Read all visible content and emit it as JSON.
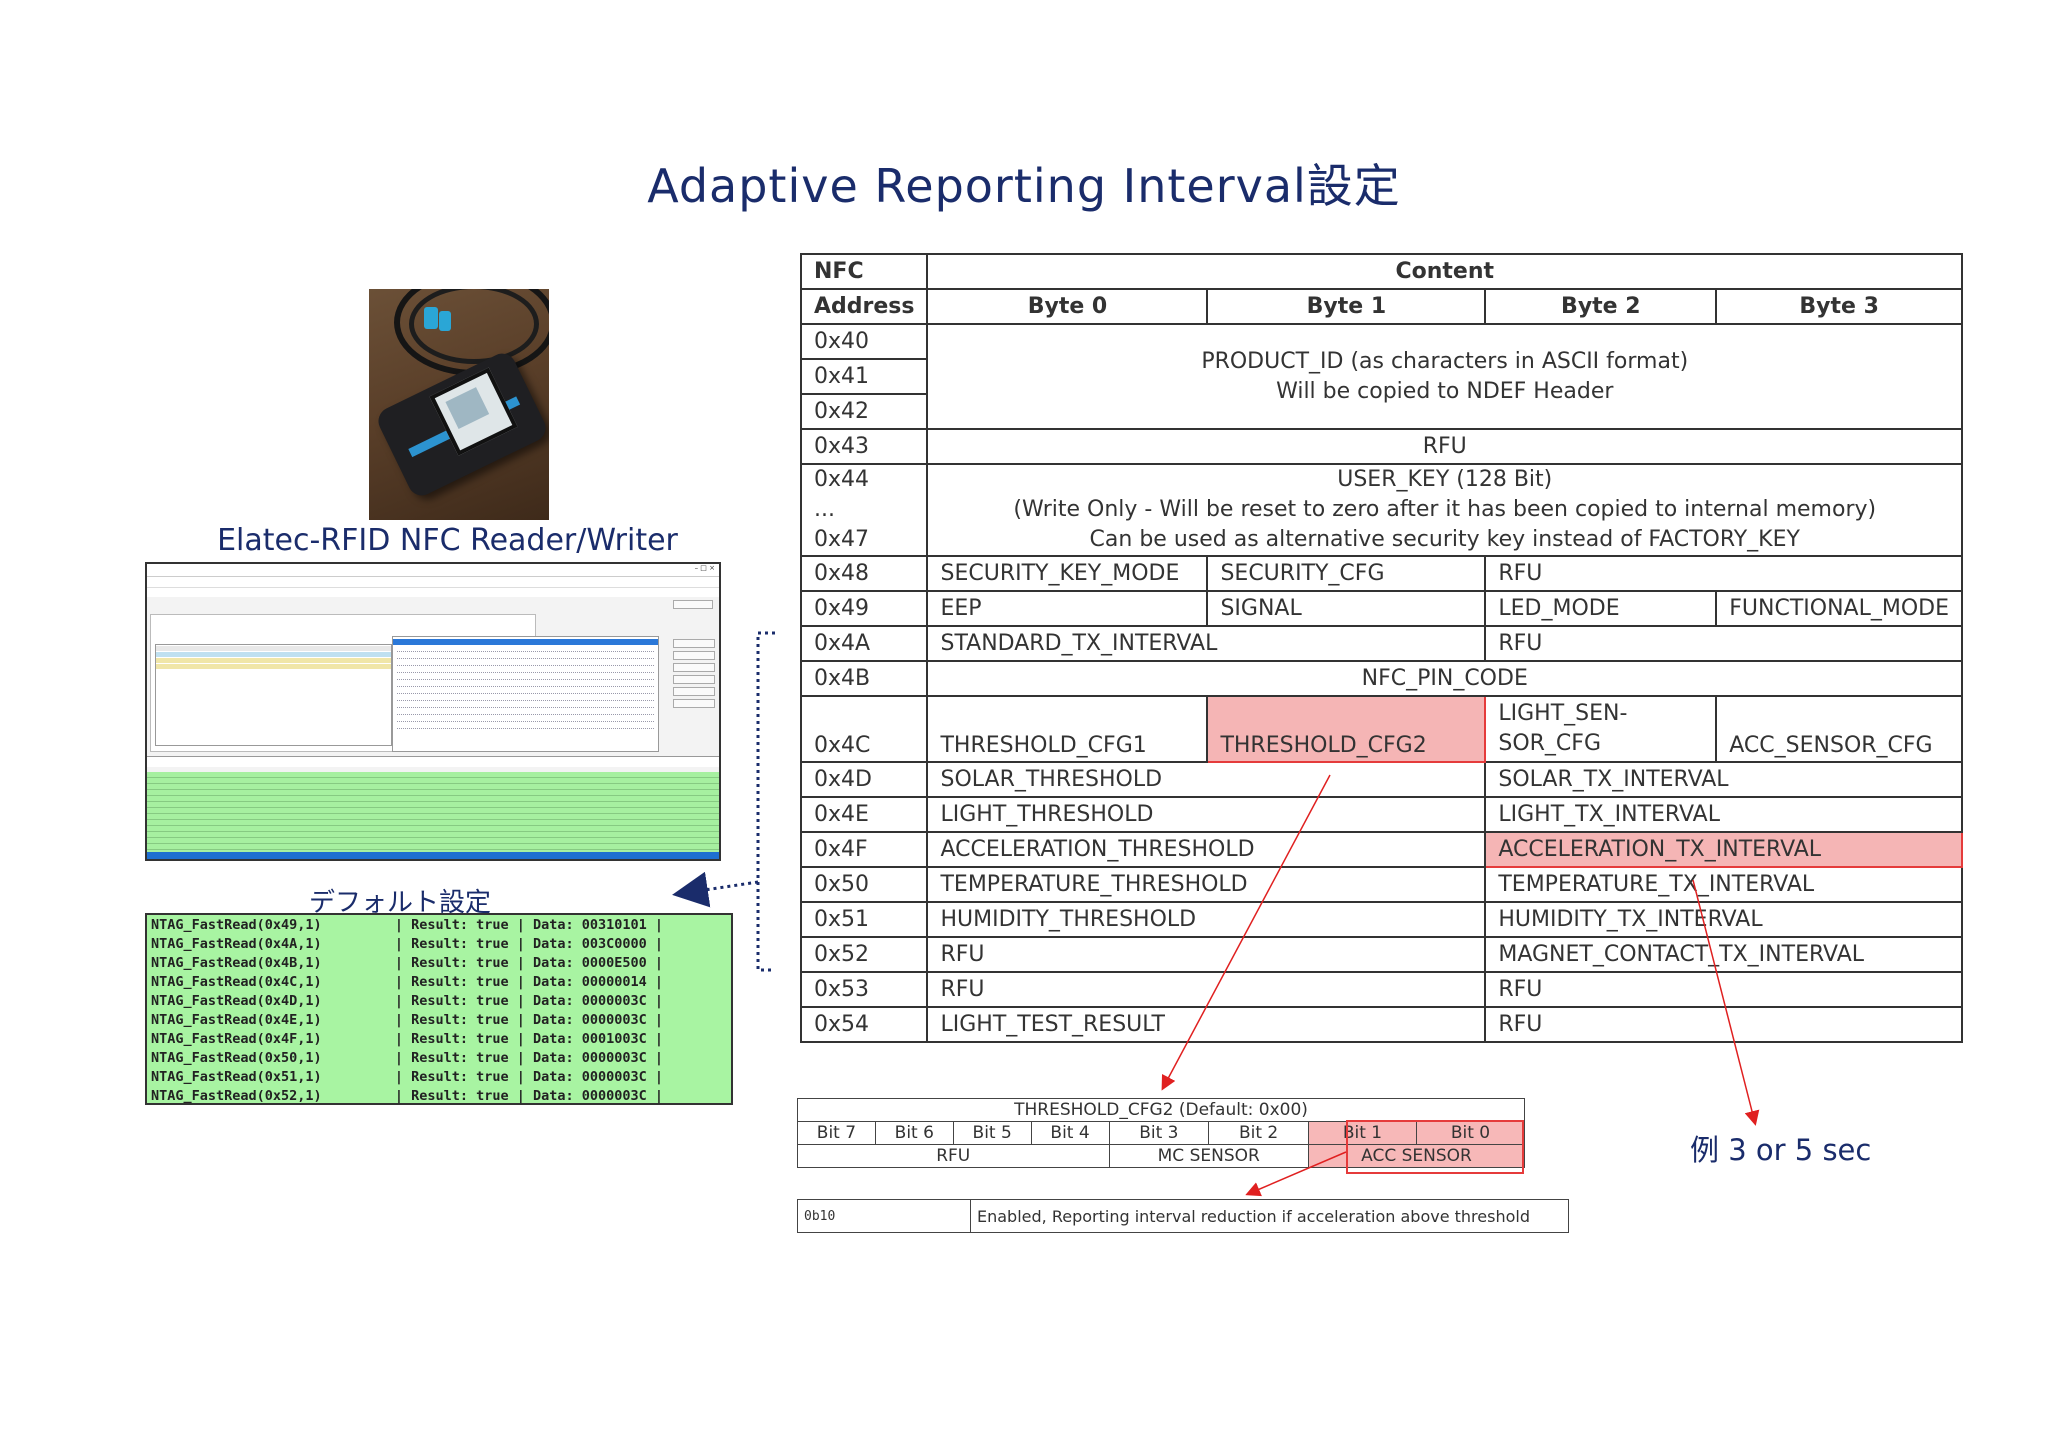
{
  "title": "Adaptive  Reporting  Interval設定",
  "reader_caption": "Elatec-RFID NFC Reader/Writer",
  "default_caption": "デフォルト設定",
  "example_note": "例 3 or 5 sec",
  "console_lines": [
    "NTAG_FastRead(0x49,1)         | Result: true | Data: 00310101 |",
    "NTAG_FastRead(0x4A,1)         | Result: true | Data: 003C0000 |",
    "NTAG_FastRead(0x4B,1)         | Result: true | Data: 0000E500 |",
    "NTAG_FastRead(0x4C,1)         | Result: true | Data: 00000014 |",
    "NTAG_FastRead(0x4D,1)         | Result: true | Data: 0000003C |",
    "NTAG_FastRead(0x4E,1)         | Result: true | Data: 0000003C |",
    "NTAG_FastRead(0x4F,1)         | Result: true | Data: 0001003C |",
    "NTAG_FastRead(0x50,1)         | Result: true | Data: 0000003C |",
    "NTAG_FastRead(0x51,1)         | Result: true | Data: 0000003C |",
    "NTAG_FastRead(0x52,1)         | Result: true | Data: 0000003C |"
  ],
  "register_table": {
    "header": {
      "nfc": "NFC",
      "address": "Address",
      "content": "Content",
      "byte0": "Byte 0",
      "byte1": "Byte 1",
      "byte2": "Byte 2",
      "byte3": "Byte 3"
    },
    "addr": {
      "a40": "0x40",
      "a41": "0x41",
      "a42": "0x42",
      "a43": "0x43",
      "a44": "0x44",
      "dots": "...",
      "a47": "0x47",
      "a48": "0x48",
      "a49": "0x49",
      "a4a": "0x4A",
      "a4b": "0x4B",
      "a4c": "0x4C",
      "a4d": "0x4D",
      "a4e": "0x4E",
      "a4f": "0x4F",
      "a50": "0x50",
      "a51": "0x51",
      "a52": "0x52",
      "a53": "0x53",
      "a54": "0x54"
    },
    "product_id_1": "PRODUCT_ID (as characters in ASCII format)",
    "product_id_2": "Will be copied to NDEF Header",
    "rfu": "RFU",
    "user_key_1": "USER_KEY (128 Bit)",
    "user_key_2": "(Write Only - Will be reset to zero after it has been copied to internal memory)",
    "user_key_3": "Can be used as alternative security key instead of FACTORY_KEY",
    "security_key_mode": "SECURITY_KEY_MODE",
    "security_cfg": "SECURITY_CFG",
    "eep": "EEP",
    "signal": "SIGNAL",
    "led_mode": "LED_MODE",
    "functional_mode": "FUNCTIONAL_MODE",
    "standard_tx_interval": "STANDARD_TX_INTERVAL",
    "nfc_pin_code": "NFC_PIN_CODE",
    "threshold_cfg1": "THRESHOLD_CFG1",
    "threshold_cfg2": "THRESHOLD_CFG2",
    "light_sensor_cfg_1": "LIGHT_SEN-",
    "light_sensor_cfg_2": "SOR_CFG",
    "acc_sensor_cfg": "ACC_SENSOR_CFG",
    "solar_threshold": "SOLAR_THRESHOLD",
    "solar_tx_interval": "SOLAR_TX_INTERVAL",
    "light_threshold": "LIGHT_THRESHOLD",
    "light_tx_interval": "LIGHT_TX_INTERVAL",
    "acceleration_threshold": "ACCELERATION_THRESHOLD",
    "acceleration_tx_interval": "ACCELERATION_TX_INTERVAL",
    "temperature_threshold": "TEMPERATURE_THRESHOLD",
    "temperature_tx_interval": "TEMPERATURE_TX_INTERVAL",
    "humidity_threshold": "HUMIDITY_THRESHOLD",
    "humidity_tx_interval": "HUMIDITY_TX_INTERVAL",
    "magnet_contact_tx_interval": "MAGNET_CONTACT_TX_INTERVAL",
    "light_test_result": "LIGHT_TEST_RESULT"
  },
  "threshold_table": {
    "title": "THRESHOLD_CFG2 (Default: 0x00)",
    "bits": [
      "Bit 7",
      "Bit 6",
      "Bit 5",
      "Bit 4",
      "Bit 3",
      "Bit 2",
      "Bit 1",
      "Bit 0"
    ],
    "rfu": "RFU",
    "mc_sensor": "MC SENSOR",
    "acc_sensor": "ACC SENSOR"
  },
  "enable_table": {
    "code": "0b10",
    "description": "Enabled, Reporting interval reduction if acceleration above threshold"
  },
  "colors": {
    "title": "#1a2c6b",
    "highlight_fill": "#f5b5b5",
    "highlight_border": "#e53b3b",
    "console_green": "#a8f4a2",
    "arrow": "#e02020"
  }
}
